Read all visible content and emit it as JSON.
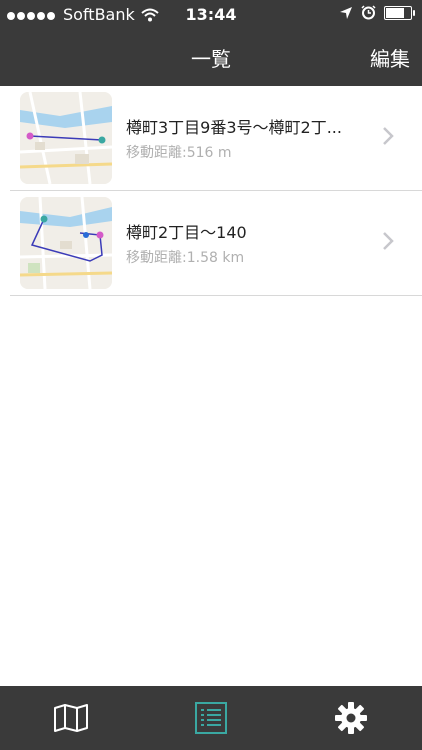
{
  "status_bar": {
    "carrier": "SoftBank",
    "time": "13:44",
    "battery_percent": 80
  },
  "nav": {
    "title": "一覧",
    "edit_label": "編集"
  },
  "routes": [
    {
      "title": "樽町3丁目9番3号〜樽町2丁...",
      "distance": "移動距離:516 m"
    },
    {
      "title": "樽町2丁目〜140",
      "distance": "移動距離:1.58 km"
    }
  ],
  "tabbar": {
    "tabs": [
      {
        "icon": "map-icon",
        "selected": false
      },
      {
        "icon": "list-icon",
        "selected": true
      },
      {
        "icon": "gear-icon",
        "selected": false
      }
    ],
    "accent_color": "#3aa8a2",
    "icon_color": "#ffffff"
  },
  "colors": {
    "bar_background": "#3a3a3a",
    "route_line": "#3b3bb8",
    "subtext": "#b0b0b0"
  }
}
